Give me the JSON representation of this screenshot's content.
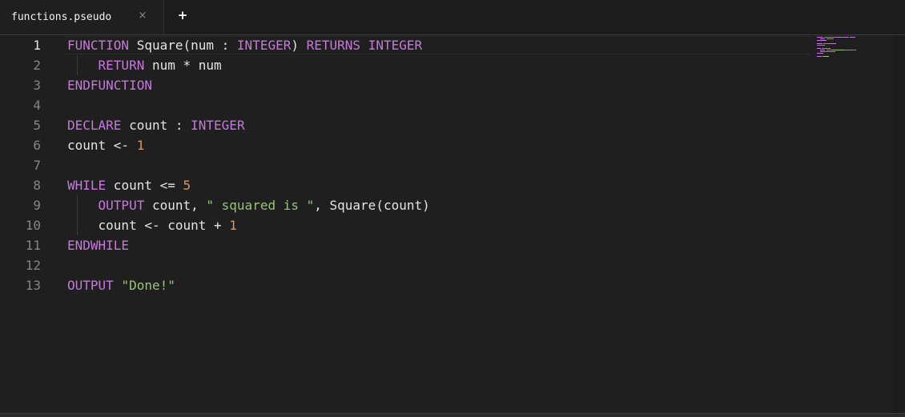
{
  "tabs": [
    {
      "title": "functions.pseudo",
      "close_glyph": "×",
      "active": true
    }
  ],
  "new_tab_glyph": "+",
  "colors": {
    "keyword": "#c678dd",
    "number": "#d19a66",
    "string": "#98c379",
    "text": "#e4e4e4",
    "background": "#1f1f1f"
  },
  "editor": {
    "active_line": 1,
    "lines": [
      {
        "num": "1",
        "tokens": [
          {
            "t": "kw",
            "v": "FUNCTION"
          },
          {
            "t": "",
            "v": " Square(num : "
          },
          {
            "t": "kw",
            "v": "INTEGER"
          },
          {
            "t": "",
            "v": ") "
          },
          {
            "t": "kw",
            "v": "RETURNS"
          },
          {
            "t": "",
            "v": " "
          },
          {
            "t": "kw",
            "v": "INTEGER"
          }
        ]
      },
      {
        "num": "2",
        "guide": true,
        "tokens": [
          {
            "t": "",
            "v": "    "
          },
          {
            "t": "kw",
            "v": "RETURN"
          },
          {
            "t": "",
            "v": " num * num"
          }
        ]
      },
      {
        "num": "3",
        "tokens": [
          {
            "t": "kw",
            "v": "ENDFUNCTION"
          }
        ]
      },
      {
        "num": "4",
        "tokens": []
      },
      {
        "num": "5",
        "tokens": [
          {
            "t": "kw",
            "v": "DECLARE"
          },
          {
            "t": "",
            "v": " count : "
          },
          {
            "t": "kw",
            "v": "INTEGER"
          }
        ]
      },
      {
        "num": "6",
        "tokens": [
          {
            "t": "",
            "v": "count <- "
          },
          {
            "t": "num",
            "v": "1"
          }
        ]
      },
      {
        "num": "7",
        "tokens": []
      },
      {
        "num": "8",
        "tokens": [
          {
            "t": "kw",
            "v": "WHILE"
          },
          {
            "t": "",
            "v": " count <= "
          },
          {
            "t": "num",
            "v": "5"
          }
        ]
      },
      {
        "num": "9",
        "guide": true,
        "tokens": [
          {
            "t": "",
            "v": "    "
          },
          {
            "t": "kw",
            "v": "OUTPUT"
          },
          {
            "t": "",
            "v": " count, "
          },
          {
            "t": "str",
            "v": "\" squared is \""
          },
          {
            "t": "",
            "v": ", Square(count)"
          }
        ]
      },
      {
        "num": "10",
        "guide": true,
        "tokens": [
          {
            "t": "",
            "v": "    count <- count + "
          },
          {
            "t": "num",
            "v": "1"
          }
        ]
      },
      {
        "num": "11",
        "tokens": [
          {
            "t": "kw",
            "v": "ENDWHILE"
          }
        ]
      },
      {
        "num": "12",
        "tokens": []
      },
      {
        "num": "13",
        "tokens": [
          {
            "t": "kw",
            "v": "OUTPUT"
          },
          {
            "t": "",
            "v": " "
          },
          {
            "t": "str",
            "v": "\"Done!\""
          }
        ]
      }
    ]
  }
}
